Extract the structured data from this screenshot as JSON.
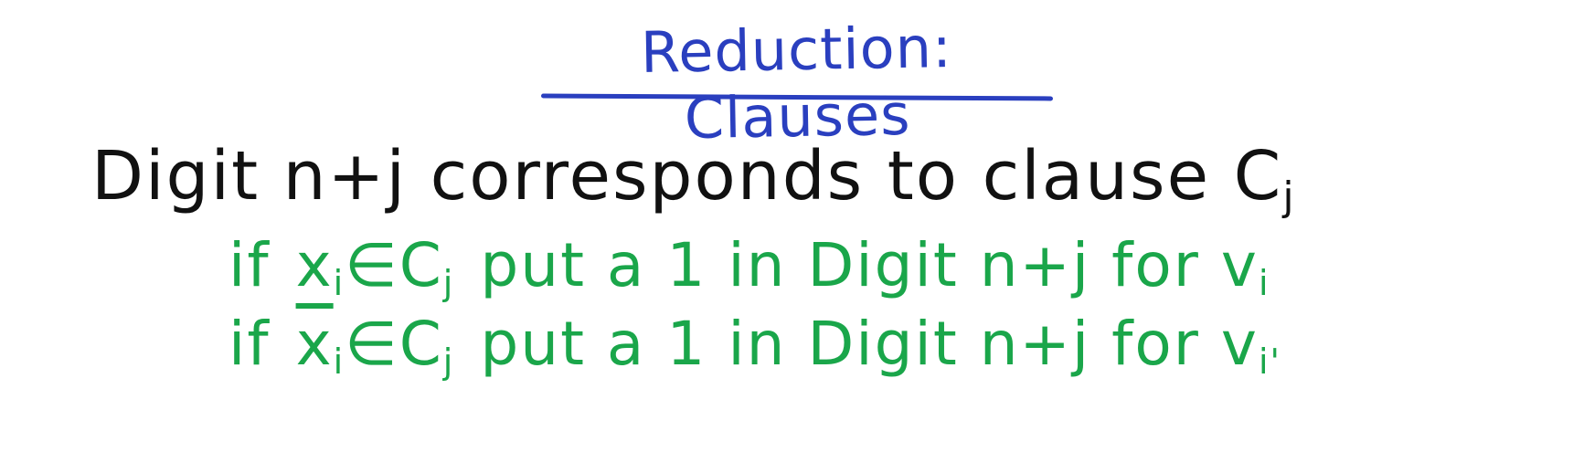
{
  "title": "Reduction: Clauses",
  "main": {
    "text": "Digit n+j corresponds to clause C",
    "sub": "j"
  },
  "rules": [
    {
      "if": "if",
      "lit": "x",
      "lit_sub": "i",
      "in": "∈C",
      "in_sub": "j",
      "action": "put a 1 in Digit n+j for v",
      "target_sub": "i"
    },
    {
      "if": "if",
      "lit": "x",
      "lit_sub": "i",
      "in": "∈C",
      "in_sub": "j",
      "action": "put a 1 in Digit n+j for v",
      "target_sub": "i'"
    }
  ]
}
